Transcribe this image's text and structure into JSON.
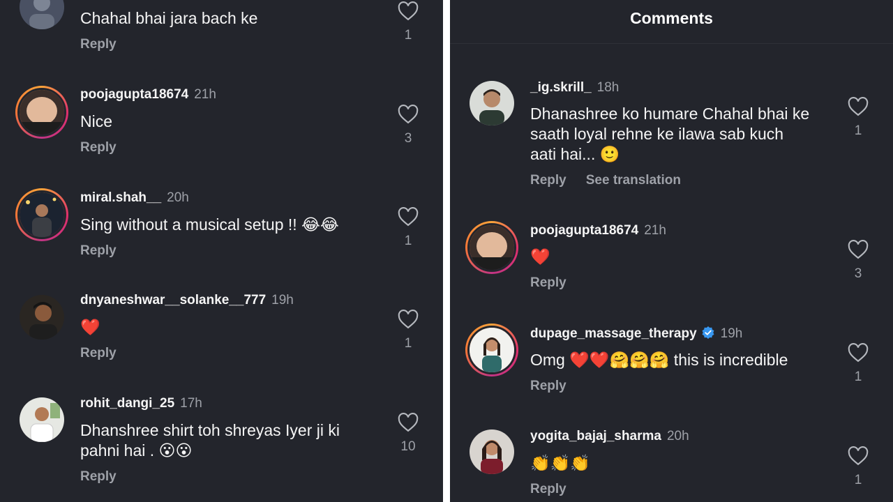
{
  "left_panel": {
    "comments": [
      {
        "username": "",
        "time": "",
        "text": "Chahal bhai jara bach ke",
        "reply_label": "Reply",
        "likes": "1"
      },
      {
        "username": "poojagupta18674",
        "time": "21h",
        "text": "Nice",
        "reply_label": "Reply",
        "likes": "3"
      },
      {
        "username": "miral.shah__",
        "time": "20h",
        "text": "Sing without a musical setup !! 😂😂",
        "reply_label": "Reply",
        "likes": "1"
      },
      {
        "username": "dnyaneshwar__solanke__777",
        "time": "19h",
        "text": "❤️",
        "reply_label": "Reply",
        "likes": "1"
      },
      {
        "username": "rohit_dangi_25",
        "time": "17h",
        "text_line1": "Dhanshree shirt toh shreyas Iyer ji ki",
        "text_line2": "pahni hai . 😮😮",
        "reply_label": "Reply",
        "likes": "10"
      }
    ]
  },
  "right_panel": {
    "header_title": "Comments",
    "comments": [
      {
        "username": "_ig.skrill_",
        "time": "18h",
        "text_line1": "Dhanashree ko humare Chahal bhai ke",
        "text_line2": "saath loyal rehne ke ilawa sab kuch",
        "text_line3": "aati hai... 🙂",
        "reply_label": "Reply",
        "translate_label": "See translation",
        "likes": "1"
      },
      {
        "username": "poojagupta18674",
        "time": "21h",
        "text": "❤️",
        "reply_label": "Reply",
        "likes": "3"
      },
      {
        "username": "dupage_massage_therapy",
        "time": "19h",
        "text": "Omg ❤️❤️🤗🤗🤗 this is incredible",
        "reply_label": "Reply",
        "likes": "1",
        "verified": true
      },
      {
        "username": "yogita_bajaj_sharma",
        "time": "20h",
        "text": "👏👏👏",
        "reply_label": "Reply",
        "likes": "1"
      }
    ]
  },
  "colors": {
    "background": "#23252c",
    "text_primary": "#f5f5f5",
    "text_secondary": "#9ea1a8",
    "story_ring": "#e1306c",
    "verified": "#3897f0",
    "heart_emoji": "#e8232f"
  },
  "icons": {
    "like": "heart-outline-icon",
    "verified": "verified-badge-icon"
  }
}
